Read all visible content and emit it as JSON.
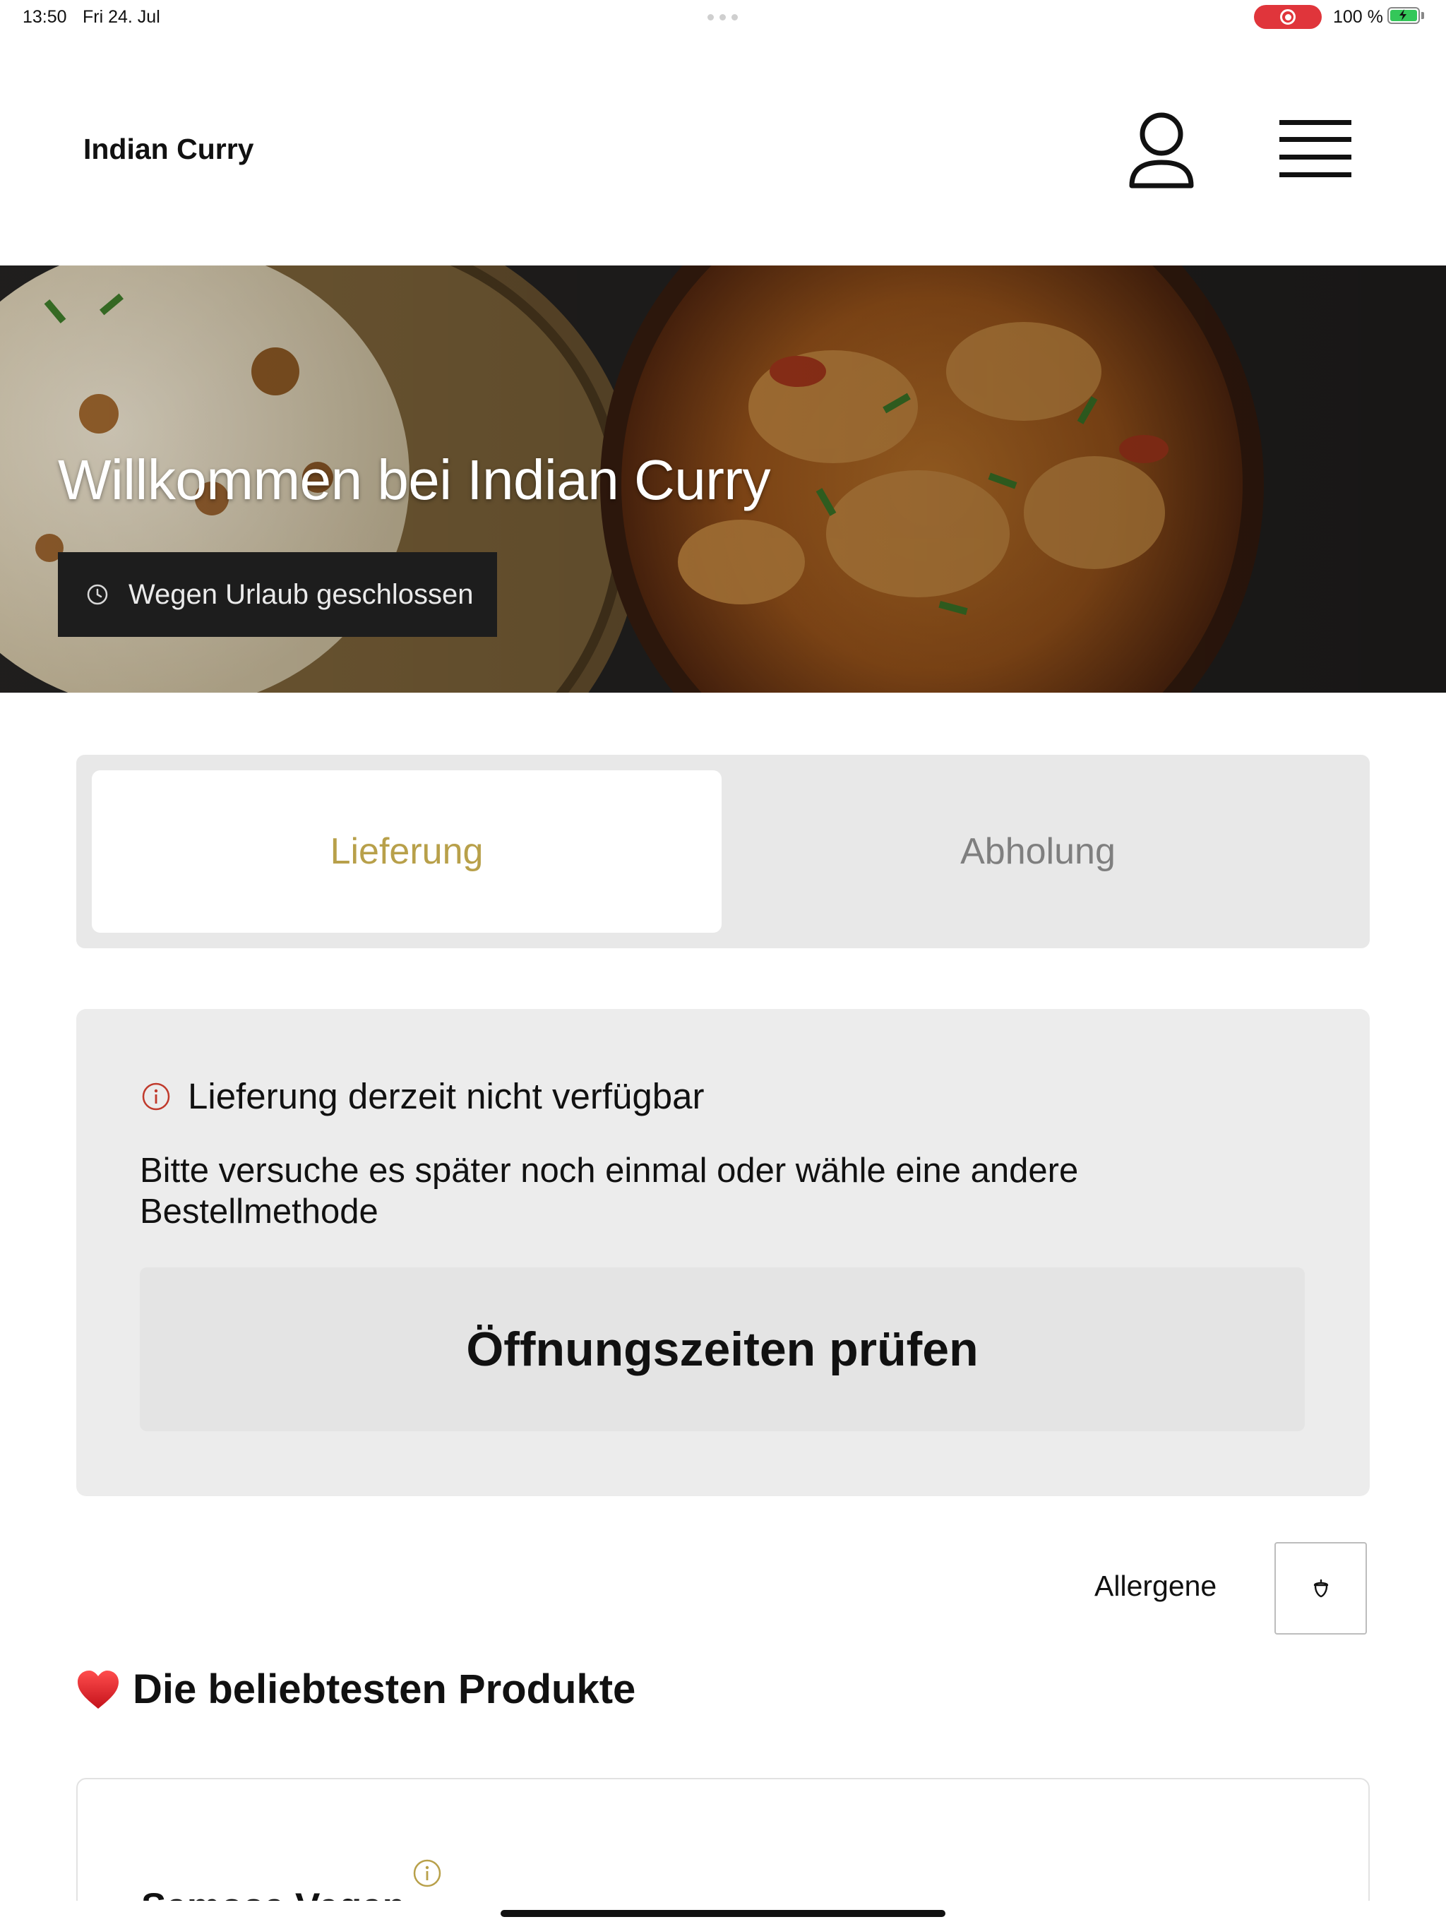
{
  "status_bar": {
    "time": "13:50",
    "date": "Fri 24. Jul",
    "battery": "100 %"
  },
  "header": {
    "brand": "Indian Curry",
    "profile_icon": "user-icon",
    "menu_icon": "hamburger-icon"
  },
  "hero": {
    "title": "Willkommen bei Indian Curry",
    "status_badge": "Wegen Urlaub geschlossen"
  },
  "order_tabs": [
    {
      "label": "Lieferung",
      "selected": true
    },
    {
      "label": "Abholung",
      "selected": false
    }
  ],
  "notice": {
    "title": "Lieferung derzeit nicht verfügbar",
    "body": "Bitte versuche es später noch einmal oder wähle eine andere Bestellmethode",
    "button_label": "Öffnungszeiten prüfen"
  },
  "allergen_filter": {
    "label": "Allergene"
  },
  "section": {
    "title": "Die beliebtesten Produkte"
  },
  "products": [
    {
      "name": "Samosa Vegan"
    }
  ],
  "colors": {
    "accent": "#b8a04a",
    "notice_icon": "#c0392b",
    "recording": "#e0353b"
  }
}
